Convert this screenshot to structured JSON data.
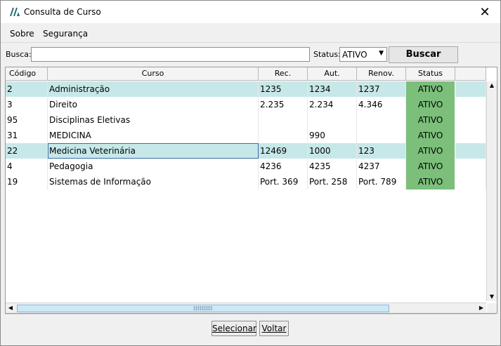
{
  "window": {
    "title": "Consulta de Curso",
    "close_glyph": "✕"
  },
  "menu": {
    "items": [
      {
        "label": "Sobre"
      },
      {
        "label": "Segurança"
      }
    ]
  },
  "search": {
    "label": "Busca:",
    "value": "",
    "status_label": "Status:",
    "status_value": "ATIVO",
    "button_label": "Buscar"
  },
  "table": {
    "headers": [
      "Código",
      "Curso",
      "Rec.",
      "Aut.",
      "Renov.",
      "Status",
      ""
    ],
    "rows": [
      {
        "codigo": "2",
        "curso": "Administração",
        "rec": "1235",
        "aut": "1234",
        "renov": "1237",
        "status": "ATIVO"
      },
      {
        "codigo": "3",
        "curso": "Direito",
        "rec": "2.235",
        "aut": "2.234",
        "renov": "4.346",
        "status": "ATIVO"
      },
      {
        "codigo": "95",
        "curso": "Disciplinas Eletivas",
        "rec": "",
        "aut": "",
        "renov": "",
        "status": "ATIVO"
      },
      {
        "codigo": "31",
        "curso": "MEDICINA",
        "rec": "",
        "aut": "990",
        "renov": "",
        "status": "ATIVO"
      },
      {
        "codigo": "22",
        "curso": "Medicina Veterinária",
        "rec": "12469",
        "aut": "1000",
        "renov": "123",
        "status": "ATIVO"
      },
      {
        "codigo": "4",
        "curso": "Pedagogia",
        "rec": "4236",
        "aut": "4235",
        "renov": "4237",
        "status": "ATIVO"
      },
      {
        "codigo": "19",
        "curso": "Sistemas de Informação",
        "rec": "Port. 369",
        "aut": "Port. 258",
        "renov": "Port. 789",
        "status": "ATIVO"
      }
    ]
  },
  "buttons": {
    "select": "Selecionar",
    "back": "Voltar"
  },
  "colors": {
    "selected_row": "#c7e8e8",
    "status_active": "#7bbf7b",
    "window_bg": "#f0f0f0"
  }
}
